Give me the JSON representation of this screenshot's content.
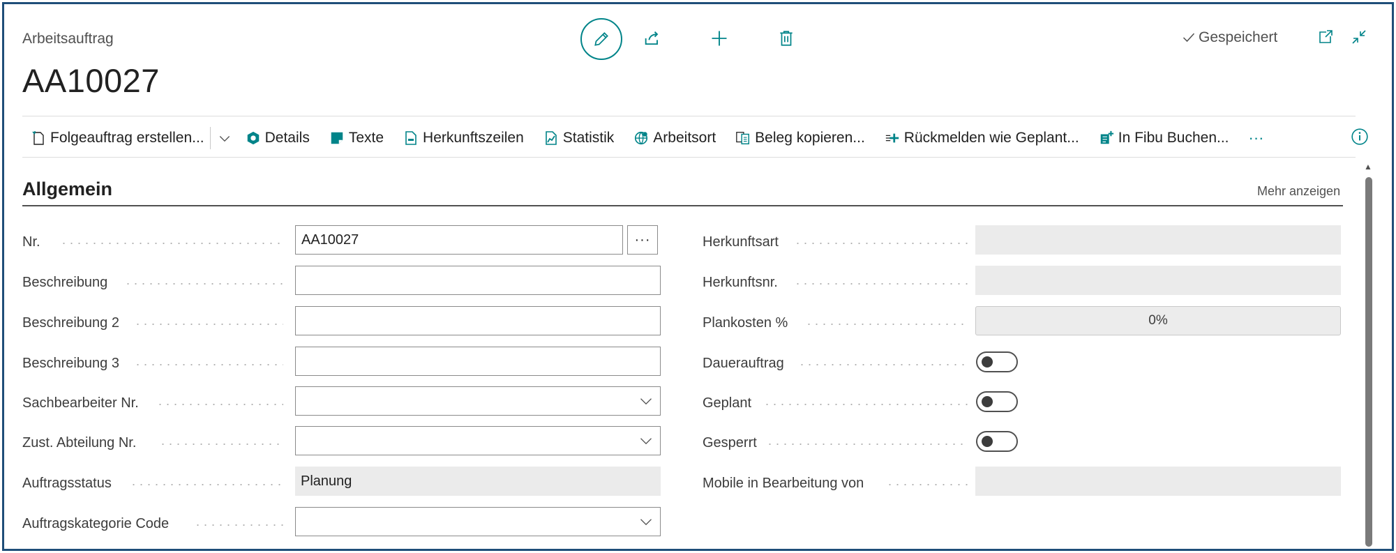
{
  "header": {
    "caption": "Arbeitsauftrag",
    "title": "AA10027",
    "status": "Gespeichert"
  },
  "toolbar": {
    "items": [
      {
        "label": "Folgeauftrag erstellen...",
        "icon": "new-document-icon"
      },
      {
        "label": "Details",
        "icon": "hexagon-icon"
      },
      {
        "label": "Texte",
        "icon": "note-icon"
      },
      {
        "label": "Herkunftszeilen",
        "icon": "document-icon"
      },
      {
        "label": "Statistik",
        "icon": "chart-icon"
      },
      {
        "label": "Arbeitsort",
        "icon": "globe-icon"
      },
      {
        "label": "Beleg kopieren...",
        "icon": "copy-icon"
      },
      {
        "label": "Rückmelden wie Geplant...",
        "icon": "post-icon"
      },
      {
        "label": "In Fibu Buchen...",
        "icon": "ledger-icon"
      }
    ],
    "more": "···"
  },
  "section": {
    "title": "Allgemein",
    "more_label": "Mehr anzeigen"
  },
  "left_fields": {
    "nr": {
      "label": "Nr.",
      "value": "AA10027",
      "assist": "···"
    },
    "beschreibung": {
      "label": "Beschreibung",
      "value": ""
    },
    "beschreibung2": {
      "label": "Beschreibung 2",
      "value": ""
    },
    "beschreibung3": {
      "label": "Beschreibung 3",
      "value": ""
    },
    "sachbearbeiter": {
      "label": "Sachbearbeiter Nr.",
      "value": ""
    },
    "abteilung": {
      "label": "Zust. Abteilung Nr.",
      "value": ""
    },
    "status": {
      "label": "Auftragsstatus",
      "value": "Planung"
    },
    "kategorie": {
      "label": "Auftragskategorie Code",
      "value": ""
    }
  },
  "right_fields": {
    "herkunftsart": {
      "label": "Herkunftsart",
      "value": ""
    },
    "herkunftsnr": {
      "label": "Herkunftsnr.",
      "value": ""
    },
    "plankosten": {
      "label": "Plankosten %",
      "value": "0%"
    },
    "dauerauftrag": {
      "label": "Dauerauftrag",
      "checked": false
    },
    "geplant": {
      "label": "Geplant",
      "checked": false
    },
    "gesperrt": {
      "label": "Gesperrt",
      "checked": false
    },
    "mobile": {
      "label": "Mobile in Bearbeitung von",
      "value": ""
    }
  },
  "colors": {
    "accent": "#008489",
    "frame": "#1f4e79",
    "readonly_bg": "#ebebeb"
  }
}
